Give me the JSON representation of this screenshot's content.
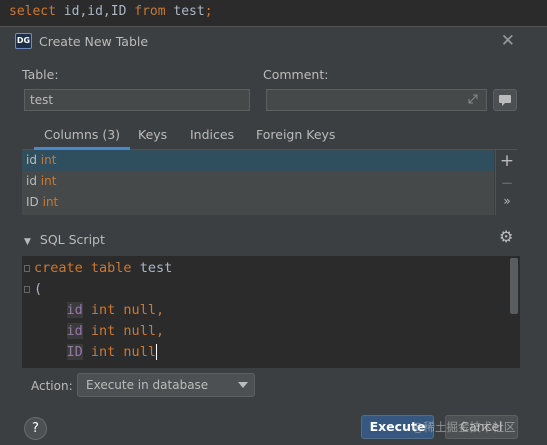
{
  "editor": {
    "kw_select": "select",
    "cols": "id,id,ID",
    "kw_from": "from",
    "table_sep": " ",
    "table": "test",
    "end": ";"
  },
  "dialog": {
    "title": "Create New Table",
    "app_logo": "DG",
    "table_label": "Table:",
    "table_value": "test",
    "comment_label": "Comment:",
    "comment_value": "",
    "tabs": [
      "Columns (3)",
      "Keys",
      "Indices",
      "Foreign Keys"
    ],
    "columns": [
      {
        "name": "id",
        "type": "int"
      },
      {
        "name": "id",
        "type": "int"
      },
      {
        "name": "ID",
        "type": "int"
      }
    ],
    "tools": {
      "add": "+",
      "remove": "−",
      "more": "»"
    },
    "sql_section_label": "SQL Script",
    "sql": {
      "l1_kw1": "create",
      "l1_kw2": "table",
      "l1_name": "test",
      "l2": "(",
      "rows": [
        {
          "name": "id",
          "rest": "int null,"
        },
        {
          "name": "id",
          "rest": "int null,"
        },
        {
          "name": "ID",
          "rest": "int null"
        }
      ]
    },
    "action_label": "Action:",
    "action_value": "Execute in database",
    "help_label": "?",
    "execute_label": "Execute",
    "cancel_label": "Cancel",
    "watermark": "@稀土掘金技术社区"
  },
  "colors": {
    "accent": "#365880",
    "keyword": "#cc7832",
    "tab_underline": "#4a88c7"
  }
}
